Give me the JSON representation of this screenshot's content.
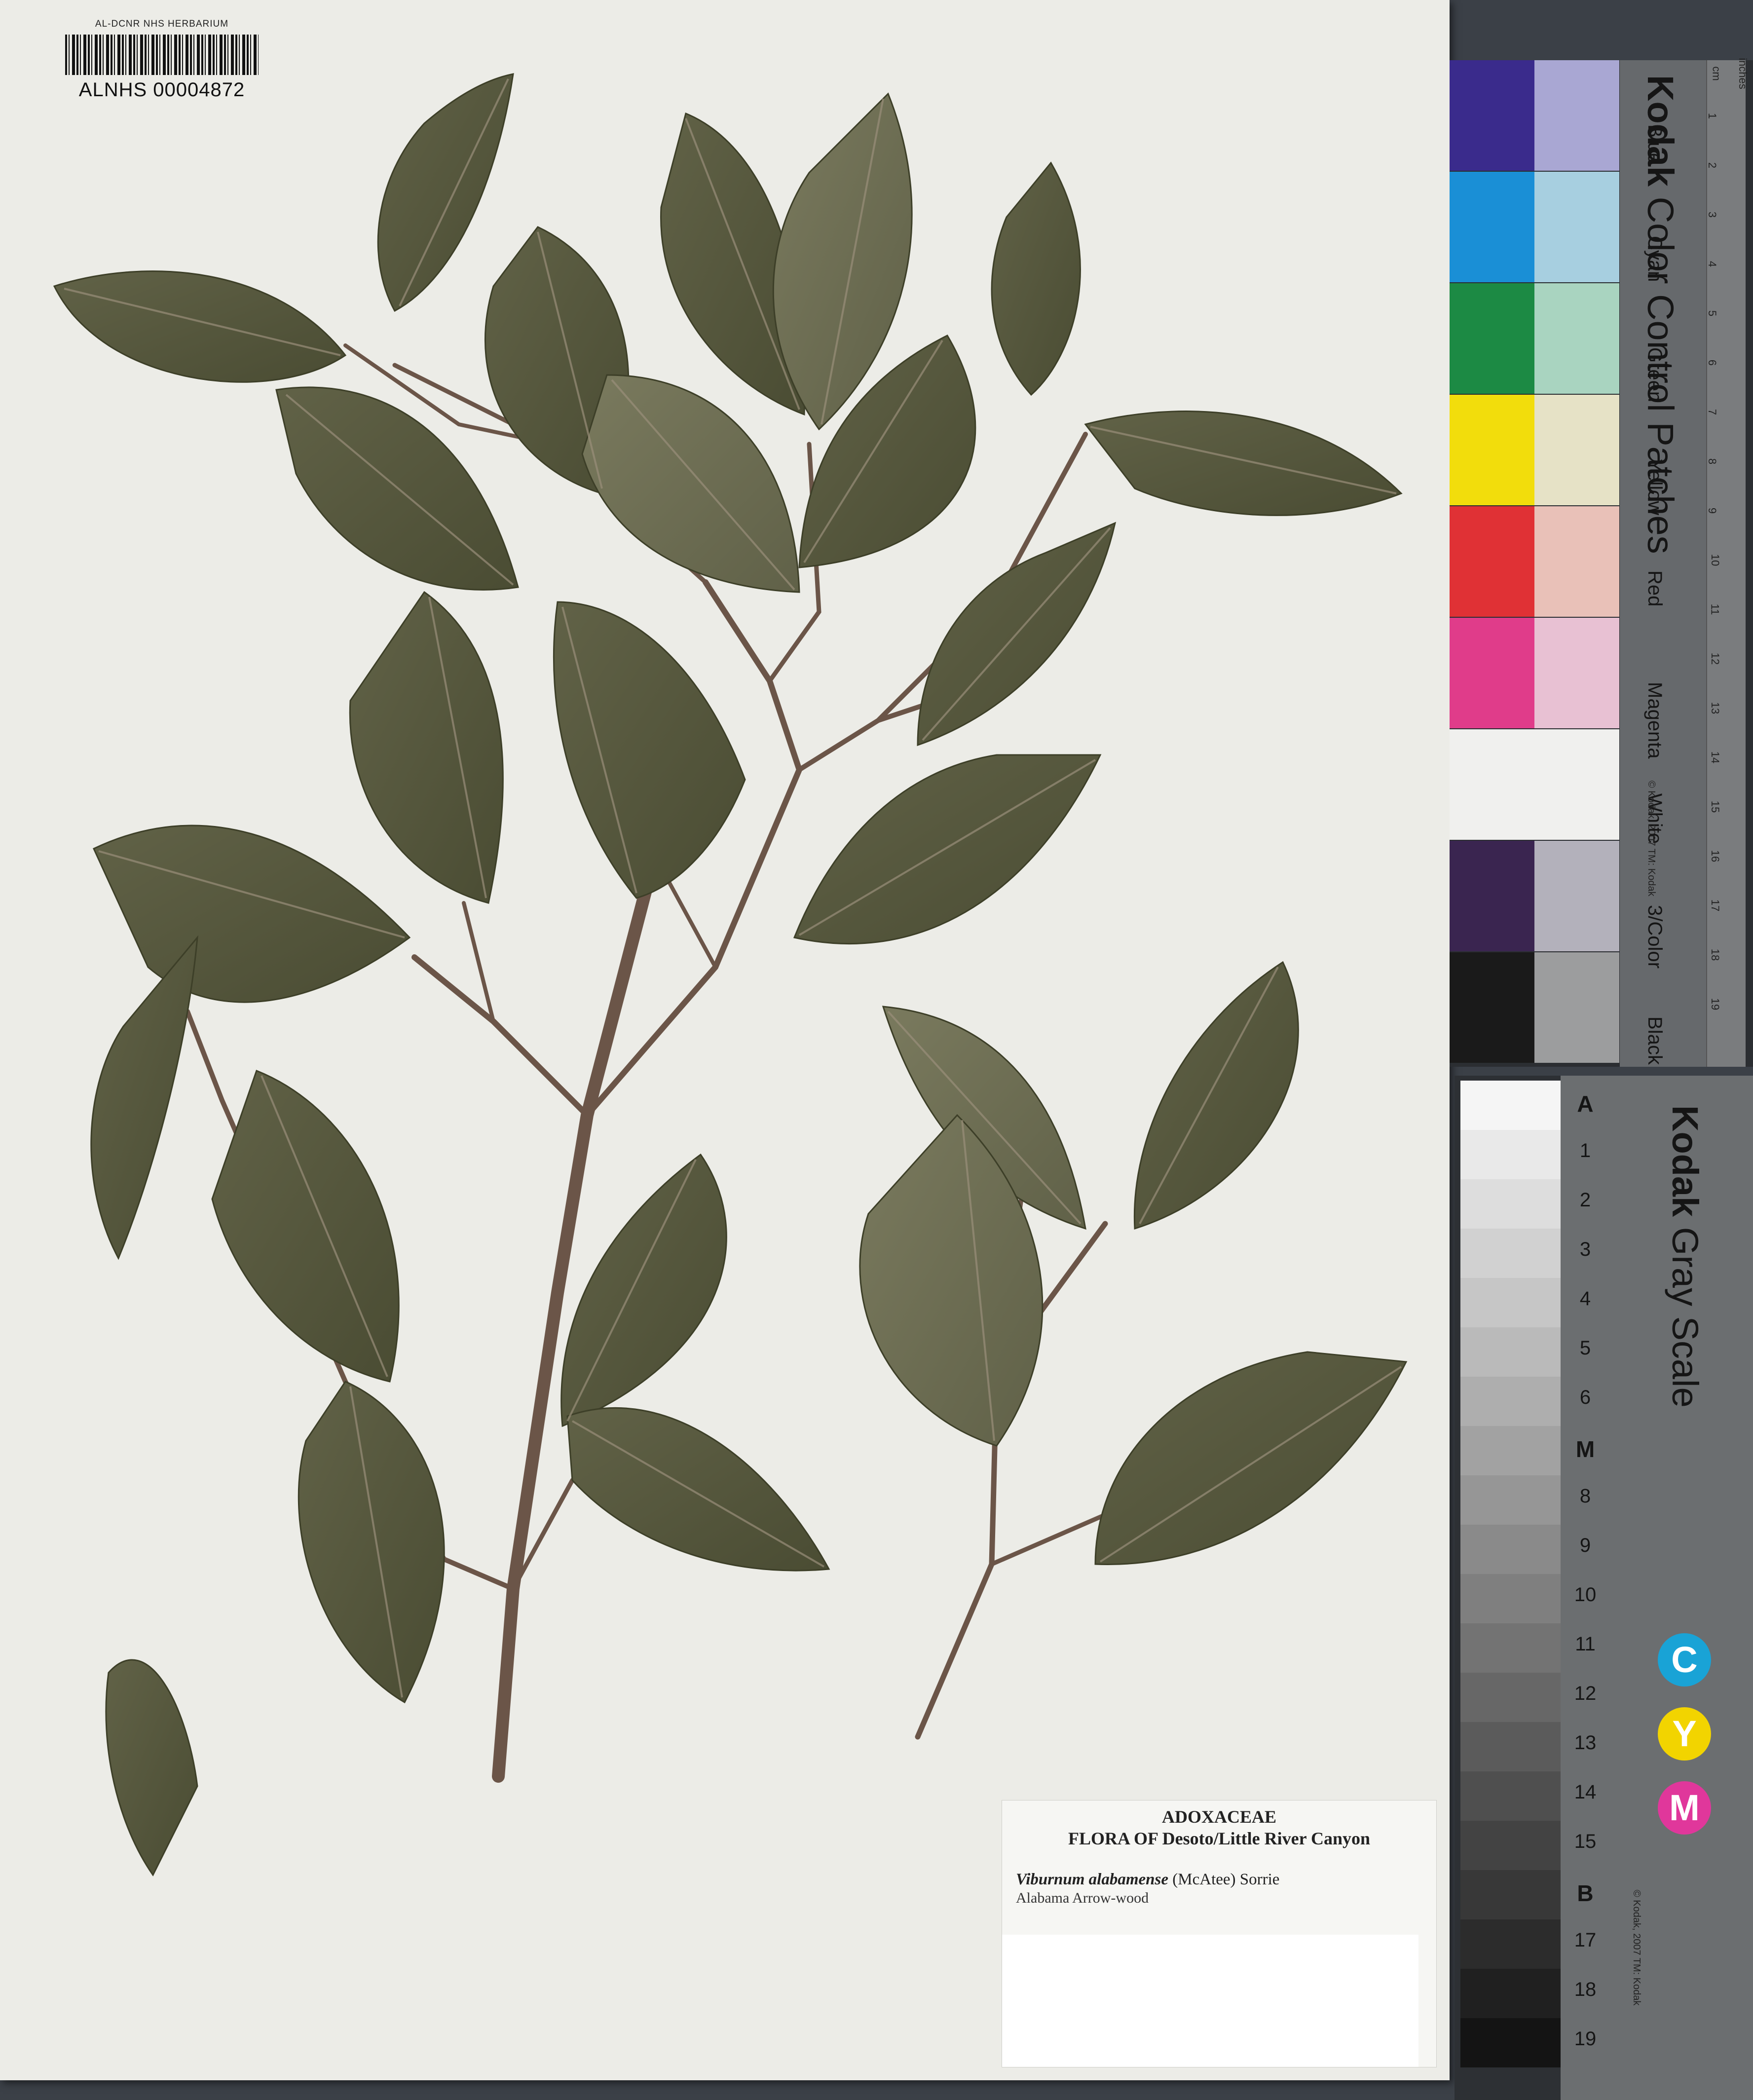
{
  "barcode": {
    "header": "AL-DCNR NHS HERBARIUM",
    "number": "ALNHS  00004872"
  },
  "label": {
    "family": "ADOXACEAE",
    "flora": "FLORA OF Desoto/Little River Canyon",
    "sci_name": "Viburnum alabamense",
    "author": " (McAtee) Sorrie",
    "common": "Alabama Arrow-wood"
  },
  "color_card": {
    "brand": "Kodak",
    "title": " Color Control Patches",
    "copyright": "© Kodak, 2007  TM: Kodak",
    "patches": [
      {
        "name": "Blue",
        "c1": "#3a2b8c",
        "c2": "#a9a7d3"
      },
      {
        "name": "Cyan",
        "c1": "#1a8fd6",
        "c2": "#a7cfe0"
      },
      {
        "name": "Green",
        "c1": "#1c8a44",
        "c2": "#a9d4c0"
      },
      {
        "name": "Yellow",
        "c1": "#f2dd0c",
        "c2": "#e6e2c6"
      },
      {
        "name": "Red",
        "c1": "#e03135",
        "c2": "#e9c1b8"
      },
      {
        "name": "Magenta",
        "c1": "#e03c8a",
        "c2": "#e8c1d3"
      },
      {
        "name": "White",
        "c1": "#f0f0ee",
        "c2": "#f0f0ee"
      },
      {
        "name": "3/Color",
        "c1": "#3a2550",
        "c2": "#b3b1bb"
      },
      {
        "name": "Black",
        "c1": "#1a1a1a",
        "c2": "#9c9d9e"
      }
    ],
    "ruler_cm": [
      "1",
      "2",
      "3",
      "4",
      "5",
      "6",
      "7",
      "8",
      "9",
      "10",
      "11",
      "12",
      "13",
      "14",
      "15",
      "16",
      "17",
      "18",
      "19"
    ],
    "ruler_labels": {
      "cm": "cm",
      "inches": "inches"
    }
  },
  "gray_card": {
    "brand": "Kodak",
    "title": " Gray Scale",
    "copyright": "© Kodak, 2007  TM: Kodak",
    "steps": [
      "A",
      "1",
      "2",
      "3",
      "4",
      "5",
      "6",
      "M",
      "8",
      "9",
      "10",
      "11",
      "12",
      "13",
      "14",
      "15",
      "B",
      "17",
      "18",
      "19"
    ],
    "cym": [
      "C",
      "Y",
      "M"
    ],
    "cym_colors": [
      "#19a3d6",
      "#f2d400",
      "#e0379b"
    ]
  },
  "colors": {
    "sheet": "#ecece7",
    "leaf": "#5a5a40",
    "leaf_dark": "#46482f",
    "stem": "#6b5548"
  }
}
